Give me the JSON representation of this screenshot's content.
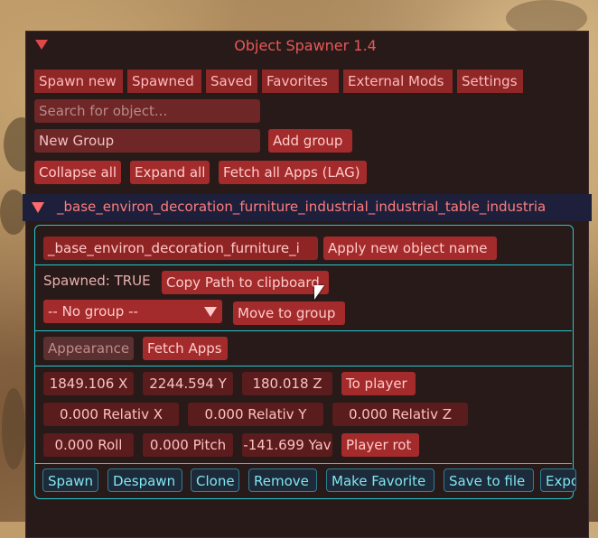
{
  "window": {
    "title": "Object Spawner 1.4"
  },
  "tabs": [
    "Spawn new",
    "Spawned",
    "Saved",
    "Favorites",
    "External Mods",
    "Settings"
  ],
  "search": {
    "placeholder": "Search for object..."
  },
  "group": {
    "name_value": "New Group",
    "add_label": "Add group"
  },
  "toolbar": {
    "collapse_label": "Collapse all",
    "expand_label": "Expand all",
    "fetch_all_label": "Fetch all Apps (LAG)"
  },
  "object": {
    "header_text": "_base_environ_decoration_furniture_industrial_industrial_table_industria",
    "name_value": "_base_environ_decoration_furniture_i",
    "apply_name_label": "Apply new object name",
    "spawned_text": "Spawned: TRUE",
    "copy_path_label": "Copy Path to clipboard",
    "group_select_value": "-- No group --",
    "move_to_group_label": "Move to group",
    "appearance_label": "Appearance",
    "fetch_apps_label": "Fetch Apps",
    "pos_x": "1849.106 X",
    "pos_y": "2244.594 Y",
    "pos_z": "180.018 Z",
    "to_player_label": "To player",
    "rel_x": "0.000 Relativ X",
    "rel_y": "0.000 Relativ Y",
    "rel_z": "0.000 Relativ Z",
    "roll": "0.000 Roll",
    "pitch": "0.000 Pitch",
    "yaw": "-141.699 Yav",
    "player_rot_label": "Player rot",
    "actions": [
      "Spawn",
      "Despawn",
      "Clone",
      "Remove",
      "Make Favorite",
      "Save to file",
      "Expo"
    ]
  },
  "colors": {
    "accent": "#a32b2b",
    "panel_border": "#29c6d0",
    "window_bg": "#271a18",
    "title": "#e85858"
  }
}
